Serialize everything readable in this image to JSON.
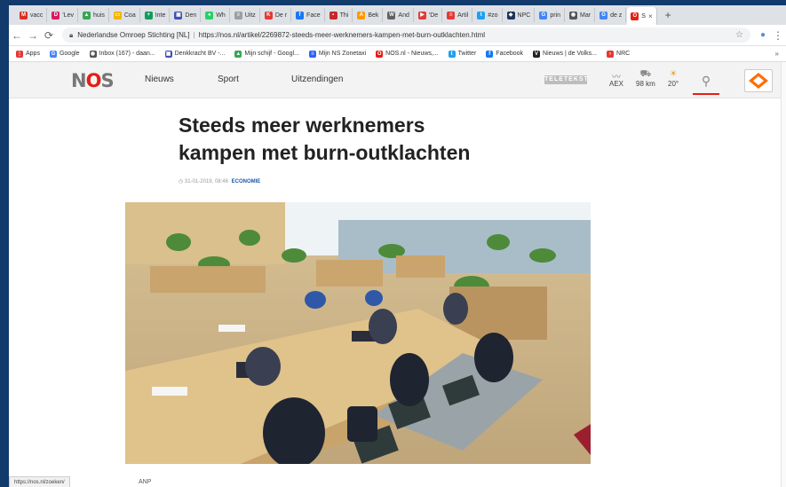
{
  "browser": {
    "tabs": [
      {
        "label": "vacc",
        "icon": "gmail-icon",
        "color": "#d93025",
        "glyph": "M"
      },
      {
        "label": "'Lev",
        "icon": "site-icon",
        "color": "#d81b60",
        "glyph": "D"
      },
      {
        "label": "huis",
        "icon": "drive-icon",
        "color": "#34a853",
        "glyph": "▲"
      },
      {
        "label": "Coa",
        "icon": "slides-icon",
        "color": "#f4b400",
        "glyph": "▭"
      },
      {
        "label": "Inte",
        "icon": "sheets-icon",
        "color": "#0f9d58",
        "glyph": "+"
      },
      {
        "label": "Den",
        "icon": "calendar-icon",
        "color": "#3f51b5",
        "glyph": "▣"
      },
      {
        "label": "Wh",
        "icon": "whatsapp-icon",
        "color": "#25d366",
        "glyph": "●"
      },
      {
        "label": "Uitz",
        "icon": "site-icon",
        "color": "#9e9e9e",
        "glyph": "≡"
      },
      {
        "label": "De r",
        "icon": "site-icon",
        "color": "#e53935",
        "glyph": "K"
      },
      {
        "label": "Face",
        "icon": "facebook-icon",
        "color": "#1877f2",
        "glyph": "f"
      },
      {
        "label": "Thi",
        "icon": "site-icon",
        "color": "#c62828",
        "glyph": "▪"
      },
      {
        "label": "Bek",
        "icon": "site-icon",
        "color": "#ff9800",
        "glyph": "A"
      },
      {
        "label": "And",
        "icon": "wikipedia-icon",
        "color": "#616161",
        "glyph": "W"
      },
      {
        "label": "'De",
        "icon": "youtube-icon",
        "color": "#e53935",
        "glyph": "▶"
      },
      {
        "label": "Artil",
        "icon": "site-icon",
        "color": "#e53935",
        "glyph": "≡"
      },
      {
        "label": "#zo",
        "icon": "twitter-icon",
        "color": "#1da1f2",
        "glyph": "t"
      },
      {
        "label": "NPC",
        "icon": "site-icon",
        "color": "#1d3557",
        "glyph": "◆"
      },
      {
        "label": "prin",
        "icon": "google-icon",
        "color": "#4285f4",
        "glyph": "G"
      },
      {
        "label": "Mar",
        "icon": "site-icon",
        "color": "#555555",
        "glyph": "◉"
      },
      {
        "label": "de z",
        "icon": "google-icon",
        "color": "#4285f4",
        "glyph": "G"
      },
      {
        "label": "S",
        "icon": "nos-icon",
        "color": "#e61e14",
        "glyph": "O",
        "active": true
      }
    ],
    "new_tab": "+",
    "address": {
      "site_name": "Nederlandse Omroep Stichting [NL]",
      "url": "https://nos.nl/artikel/2269872-steeds-meer-werknemers-kampen-met-burn-outklachten.html"
    },
    "bookmarks": [
      {
        "label": "Apps",
        "icon": "apps-grid-icon",
        "color": "#e53935",
        "glyph": "⋮"
      },
      {
        "label": "Google",
        "icon": "google-icon",
        "color": "#4285f4",
        "glyph": "G"
      },
      {
        "label": "Inbox (167) - daan...",
        "icon": "inbox-icon",
        "color": "#555555",
        "glyph": "◉"
      },
      {
        "label": "Denkkracht BV -...",
        "icon": "calendar-icon",
        "color": "#3f51b5",
        "glyph": "▣"
      },
      {
        "label": "Mijn schijf - Googl...",
        "icon": "drive-icon",
        "color": "#34a853",
        "glyph": "▲"
      },
      {
        "label": "Mijn NS Zonetaxi",
        "icon": "ns-icon",
        "color": "#2962ff",
        "glyph": "≡"
      },
      {
        "label": "NOS.nl - Nieuws,...",
        "icon": "nos-icon",
        "color": "#e61e14",
        "glyph": "O"
      },
      {
        "label": "Twitter",
        "icon": "twitter-icon",
        "color": "#1da1f2",
        "glyph": "t"
      },
      {
        "label": "Facebook",
        "icon": "facebook-icon",
        "color": "#1877f2",
        "glyph": "f"
      },
      {
        "label": "Nieuws | de Volks...",
        "icon": "volkskrant-icon",
        "color": "#222222",
        "glyph": "V"
      },
      {
        "label": "NRC",
        "icon": "nrc-icon",
        "color": "#e53935",
        "glyph": "›"
      }
    ],
    "bookmarks_more": "»",
    "status_url": "https://nos.nl/zoeken/"
  },
  "site": {
    "logo": {
      "n": "N",
      "o": "O",
      "s": "S"
    },
    "nav": [
      "Nieuws",
      "Sport",
      "Uitzendingen"
    ],
    "teletekst": "TELETEKST",
    "widgets": {
      "aex_label": "AEX",
      "traffic_value": "98 km",
      "weather_value": "20°"
    }
  },
  "article": {
    "headline_line1": "Steeds meer werknemers",
    "headline_line2": "kampen met burn-outklachten",
    "date": "31-01-2019, 08:46",
    "category": "ECONOMIE",
    "image_credit": "ANP"
  },
  "colors": {
    "brand_red": "#e61e14",
    "link_blue": "#1d5aa6"
  }
}
